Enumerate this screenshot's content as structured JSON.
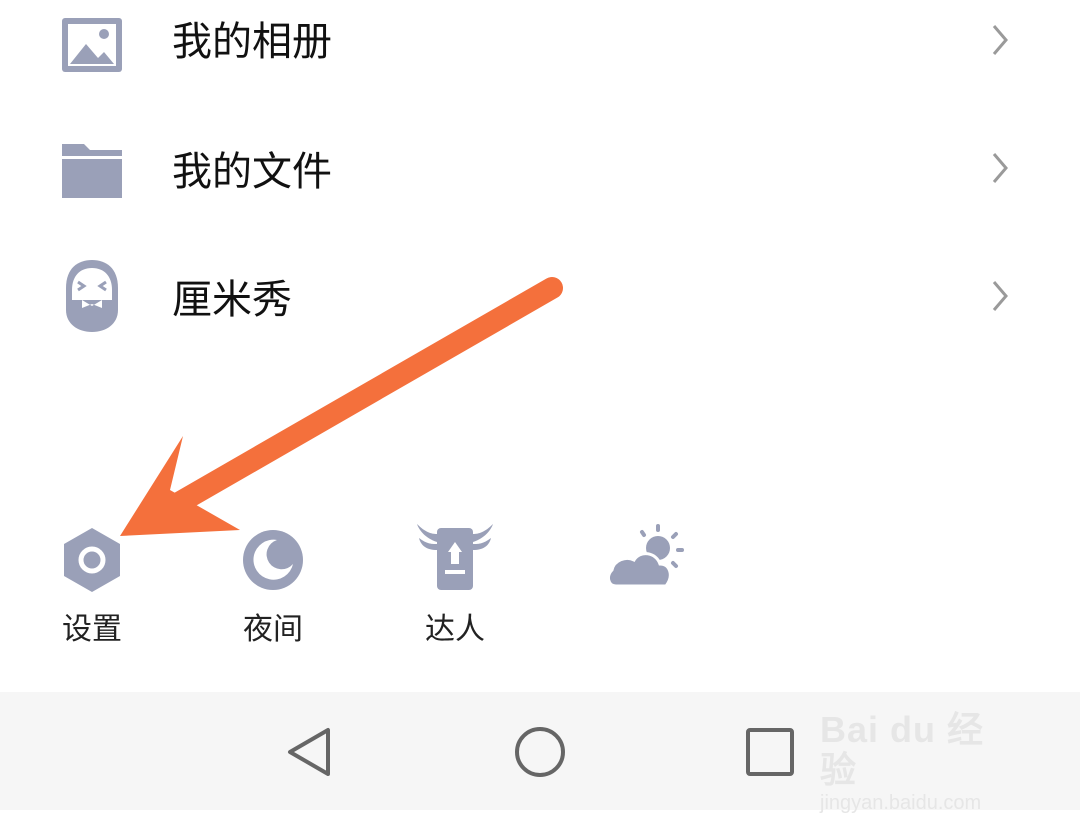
{
  "menu": {
    "items": [
      {
        "label": "我的相册",
        "icon": "photo-album-icon"
      },
      {
        "label": "我的文件",
        "icon": "folder-icon"
      },
      {
        "label": "厘米秀",
        "icon": "cmshow-mascot-icon"
      }
    ]
  },
  "quick_actions": [
    {
      "label": "设置",
      "icon": "settings-hexagon-icon"
    },
    {
      "label": "夜间",
      "icon": "moon-icon"
    },
    {
      "label": "达人",
      "icon": "winged-badge-icon"
    },
    {
      "label": "",
      "icon": "weather-cloud-sun-icon"
    }
  ],
  "nav": {
    "back_icon": "back-triangle-icon",
    "home_icon": "home-circle-icon",
    "recents_icon": "recents-square-icon"
  },
  "watermark": {
    "brand": "Bai du 经验",
    "url": "jingyan.baidu.com"
  },
  "colors": {
    "icon": "#9aa0b8",
    "arrow": "#f4703c",
    "text": "#111111",
    "navbar_bg": "#f6f6f6"
  }
}
